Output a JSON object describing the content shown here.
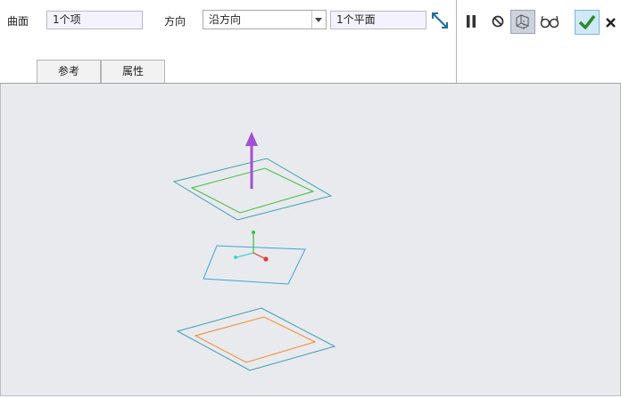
{
  "dashboard": {
    "surface_label": "曲面",
    "surface_value": "1个项",
    "direction_label": "方向",
    "direction_value": "沿方向",
    "reference_value": "1个平面",
    "tabs": [
      {
        "label": "参考"
      },
      {
        "label": "属性"
      }
    ]
  },
  "icons": {
    "flip": "flip-direction-icon",
    "pause": "pause-icon",
    "no_preview": "no-preview-icon",
    "geometry_preview": "geometry-preview-icon",
    "verify": "verify-glasses-icon",
    "ok": "checkmark-icon",
    "cancel": "close-icon"
  },
  "colors": {
    "ok_button_bg": "#cfe9f7",
    "ok_check": "#2e8a2e",
    "arrow": "#a24fd6",
    "top_outer": "#3a9fb0",
    "top_inner": "#3cbf3c",
    "middle_plane": "#3ba7d8",
    "bottom_outer": "#3a9fb0",
    "bottom_inner": "#f08c2c"
  }
}
